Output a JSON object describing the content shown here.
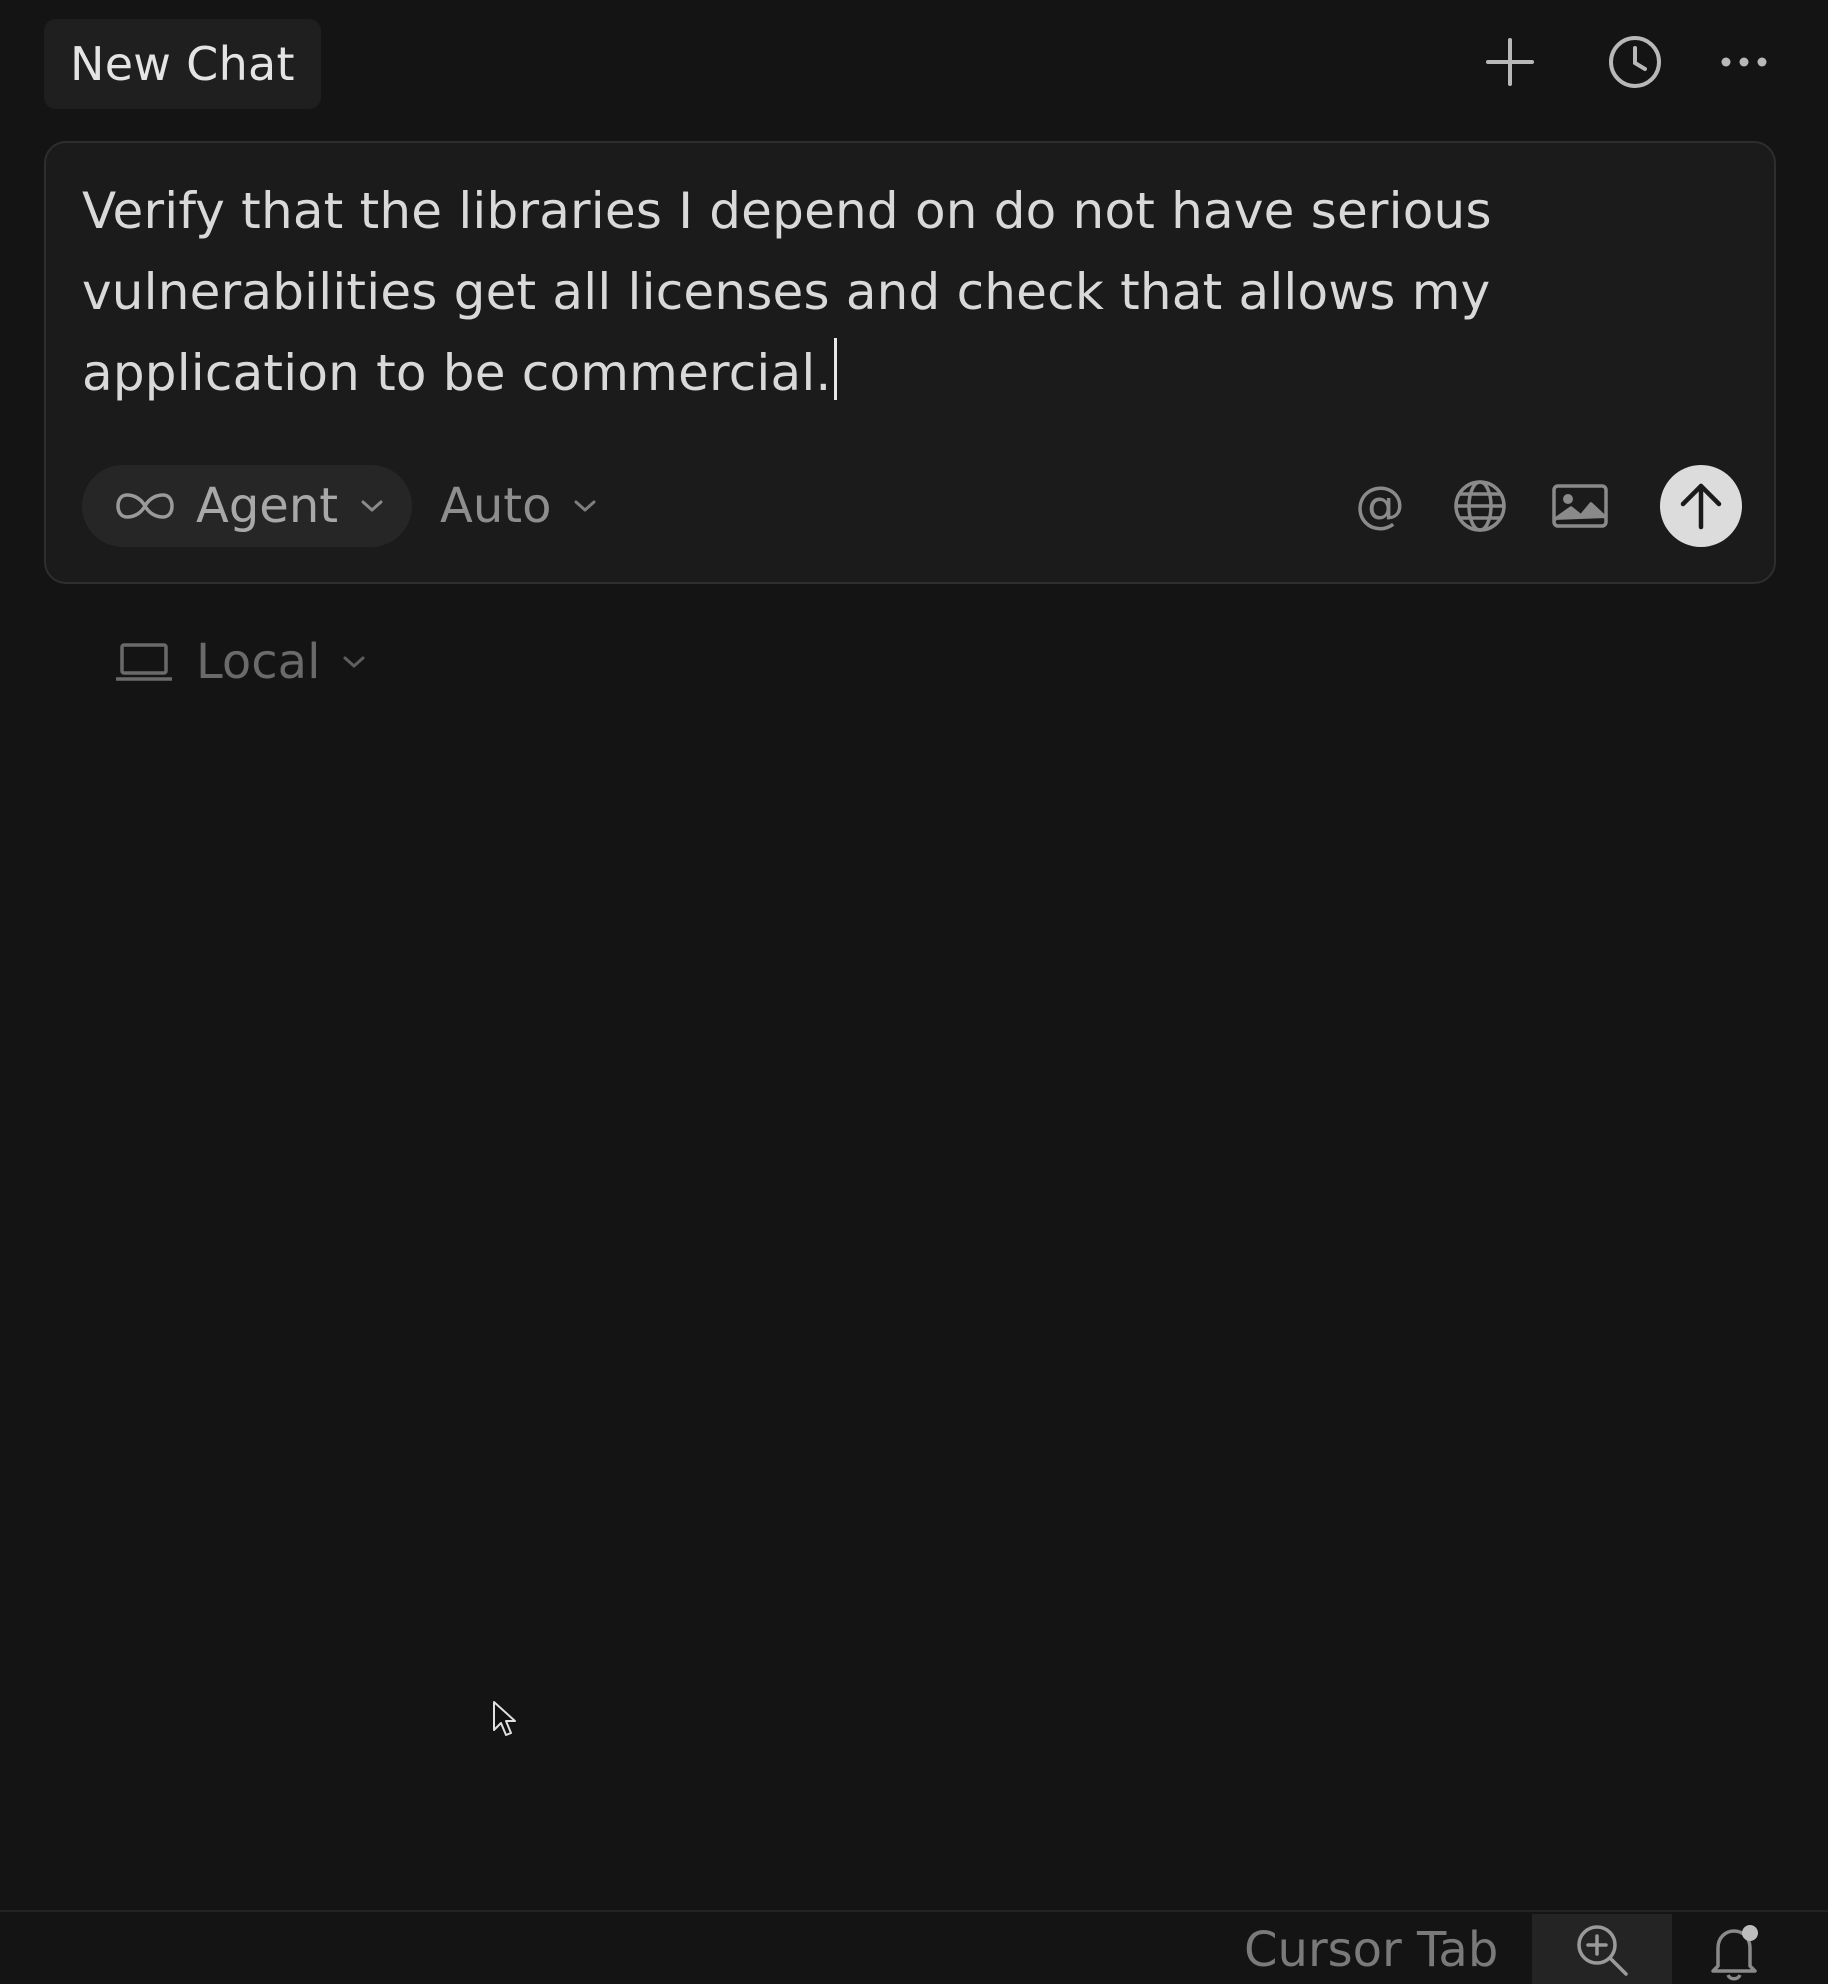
{
  "header": {
    "tab_title": "New Chat",
    "icons": [
      "plus-icon",
      "history-clock-icon",
      "more-ellipsis-icon"
    ]
  },
  "composer": {
    "prompt_text": "Verify that the libraries I depend on do not have serious vulnerabilities get all licenses and check that allows my application to be commercial.",
    "mode_label": "Agent",
    "model_label": "Auto",
    "icons": [
      "infinity-icon",
      "at-mention-icon",
      "web-globe-icon",
      "image-icon",
      "send-arrow-up-icon"
    ]
  },
  "environment": {
    "label": "Local",
    "icon": "laptop-icon"
  },
  "status_bar": {
    "label": "Cursor Tab",
    "icons": [
      "zoom-in-icon",
      "notification-bell-icon"
    ]
  },
  "colors": {
    "background": "#141414",
    "composer_bg": "#1b1b1b",
    "text_primary": "#d9d9d9",
    "send_button": "#dcdcdc"
  }
}
